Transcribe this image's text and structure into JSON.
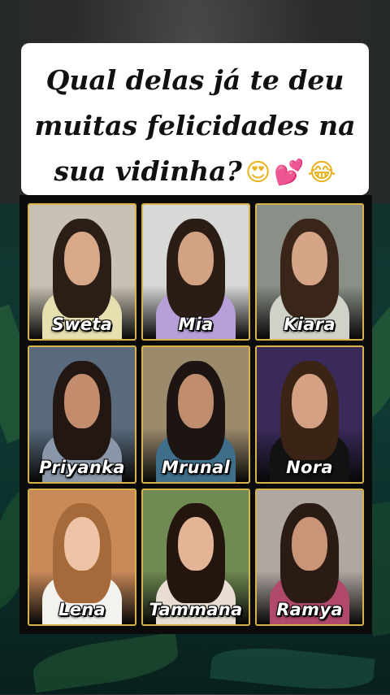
{
  "question": {
    "line1": "Qual delas já te deu",
    "line2": "muitas felicidades na",
    "line3": "sua vidinha?",
    "emojis": [
      "😍",
      "💕",
      "😂"
    ]
  },
  "tiles": [
    {
      "name": "Sweta",
      "bg": "#c9c2b4",
      "hair": "#2a1e17",
      "skin": "#d9a889",
      "top": "#e6dfb0"
    },
    {
      "name": "Mia",
      "bg": "#d7d9d6",
      "hair": "#2b1d16",
      "skin": "#d2a383",
      "top": "#b7a0d8"
    },
    {
      "name": "Kiara",
      "bg": "#8a8f88",
      "hair": "#3a2618",
      "skin": "#d6a487",
      "top": "#cfd2c8"
    },
    {
      "name": "Priyanka",
      "bg": "#586a7c",
      "hair": "#221713",
      "skin": "#c38d6d",
      "top": "#8a97a8"
    },
    {
      "name": "Mrunal",
      "bg": "#9c8a6c",
      "hair": "#1d1512",
      "skin": "#c08e6e",
      "top": "#3f6e8a"
    },
    {
      "name": "Nora",
      "bg": "#3a2a5a",
      "hair": "#3b2416",
      "skin": "#d4a184",
      "top": "#121212"
    },
    {
      "name": "Lena",
      "bg": "#c98a5a",
      "hair": "#a66a3a",
      "skin": "#efc3a6",
      "top": "#f4f2ee"
    },
    {
      "name": "Tammana",
      "bg": "#6f8a52",
      "hair": "#24160f",
      "skin": "#e3b495",
      "top": "#e7ddd2"
    },
    {
      "name": "Ramya",
      "bg": "#b0a7a2",
      "hair": "#2a1b15",
      "skin": "#c99478",
      "top": "#b14a6a"
    }
  ]
}
